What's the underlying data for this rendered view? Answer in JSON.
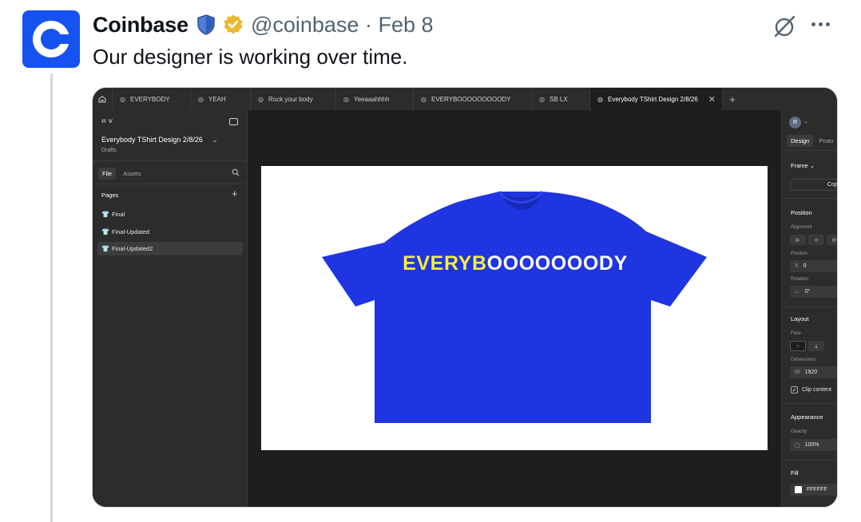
{
  "tweet": {
    "author_name": "Coinbase",
    "handle": "@coinbase",
    "separator": "·",
    "date": "Feb 8",
    "text": "Our designer is working over time.",
    "brand_color": "#1652f0",
    "avatar_icon": "coinbase-logo-icon",
    "gov_badge_icon": "shield-badge-icon",
    "verified_badge_icon": "gold-verified-badge-icon",
    "grok_icon": "grok-icon",
    "more_icon": "more-options-icon"
  },
  "figma": {
    "tabs": [
      {
        "label": "EVERYBODY",
        "active": false
      },
      {
        "label": "YEAH",
        "active": false
      },
      {
        "label": "Rock your body",
        "active": false
      },
      {
        "label": "Yeeaaahhhh",
        "active": false
      },
      {
        "label": "EVERYBOOOOOOOOODY",
        "active": false
      },
      {
        "label": "SB LX",
        "active": false
      },
      {
        "label": "Everybody TShirt Design 2/8/26",
        "active": true
      }
    ],
    "tab_close": "✕",
    "tab_plus": "+",
    "left_panel": {
      "file_title": "Everybody TShirt Design 2/8/26",
      "file_title_chevron": "⌄",
      "location": "Drafts",
      "tab_file": "File",
      "tab_assets": "Assets",
      "pages_heading": "Pages",
      "pages_plus": "+",
      "pages": [
        {
          "name": "Final",
          "selected": false
        },
        {
          "name": "Final-Updated",
          "selected": false
        },
        {
          "name": "Final-Updated2",
          "selected": true
        }
      ]
    },
    "canvas": {
      "shirt_color": "#1f35e0",
      "frame_background": "#ffffff",
      "text_part1": "EVERYB",
      "text_part2": "OOOOOOODY",
      "text_color_part1": "#f5ee3a",
      "text_color_part2": "#ffffff"
    },
    "right_panel": {
      "avatar_letter": "R",
      "tab_design": "Design",
      "tab_prototype": "Proto",
      "frame_label": "Frame",
      "copy_button": "Copy t",
      "position_heading": "Position",
      "alignment_label": "Alignment",
      "position_label": "Position",
      "x_key": "X",
      "x_value": "0",
      "rotation_label": "Rotation",
      "rotation_value": "0°",
      "layout_heading": "Layout",
      "flow_label": "Flow",
      "dimensions_label": "Dimensions",
      "w_key": "W",
      "w_value": "1920",
      "clip_content_label": "Clip content",
      "appearance_heading": "Appearance",
      "opacity_label": "Opacity",
      "opacity_value": "100%",
      "fill_heading": "Fill",
      "fill_value": "FFFFFF"
    }
  }
}
